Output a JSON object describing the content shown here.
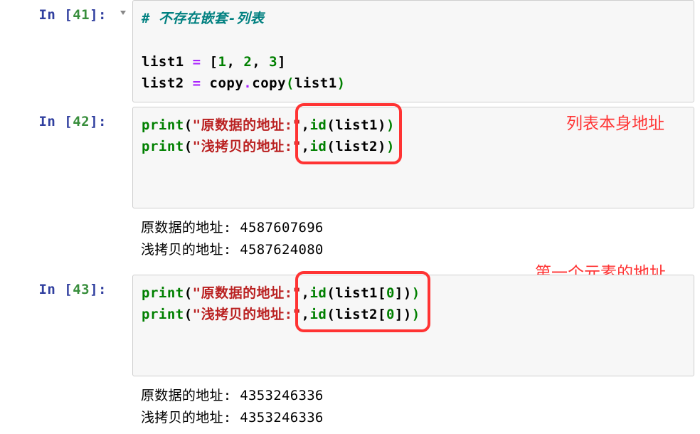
{
  "cells": {
    "c41": {
      "prompt_prefix": "In [",
      "prompt_num": "41",
      "prompt_suffix": "]:",
      "code": {
        "comment": "# 不存在嵌套-列表",
        "l1_name": "list1",
        "l1_op": " = ",
        "l1_open": "[",
        "l1_v1": "1",
        "l1_sep1": ", ",
        "l1_v2": "2",
        "l1_sep2": ", ",
        "l1_v3": "3",
        "l1_close": "]",
        "l2_name": "list2",
        "l2_op": " = ",
        "l2_mod": "copy",
        "l2_dot": ".",
        "l2_fn": "copy",
        "l2_lp": "(",
        "l2_arg": "list1",
        "l2_rp": ")"
      }
    },
    "c42": {
      "prompt_prefix": "In [",
      "prompt_num": "42",
      "prompt_suffix": "]:",
      "code": {
        "l1_fn": "print",
        "l1_lp": "(",
        "l1_str": "\"原数据的地址:\"",
        "l1_comma": ",",
        "l1_idfn": "id",
        "l1_idlp": "(",
        "l1_idarg": "list1",
        "l1_idrp": ")",
        "l1_rp": ")",
        "l2_fn": "print",
        "l2_lp": "(",
        "l2_str": "\"浅拷贝的地址:\"",
        "l2_comma": ",",
        "l2_idfn": "id",
        "l2_idlp": "(",
        "l2_idarg": "list2",
        "l2_idrp": ")",
        "l2_rp": ")"
      },
      "output": {
        "l1": "原数据的地址: 4587607696",
        "l2": "浅拷贝的地址: 4587624080"
      },
      "annotation": "列表本身地址"
    },
    "c43": {
      "prompt_prefix": "In [",
      "prompt_num": "43",
      "prompt_suffix": "]:",
      "code": {
        "l1_fn": "print",
        "l1_lp": "(",
        "l1_str": "\"原数据的地址:\"",
        "l1_comma": ",",
        "l1_idfn": "id",
        "l1_idlp": "(",
        "l1_idarg": "list1",
        "l1_idxlp": "[",
        "l1_idx": "0",
        "l1_idxrp": "]",
        "l1_idrp": ")",
        "l1_rp": ")",
        "l2_fn": "print",
        "l2_lp": "(",
        "l2_str": "\"浅拷贝的地址:\"",
        "l2_comma": ",",
        "l2_idfn": "id",
        "l2_idlp": "(",
        "l2_idarg": "list2",
        "l2_idxlp": "[",
        "l2_idx": "0",
        "l2_idxrp": "]",
        "l2_idrp": ")",
        "l2_rp": ")"
      },
      "output": {
        "l1": "原数据的地址: 4353246336",
        "l2": "浅拷贝的地址: 4353246336"
      },
      "annotation": "第一个元素的地址"
    }
  }
}
